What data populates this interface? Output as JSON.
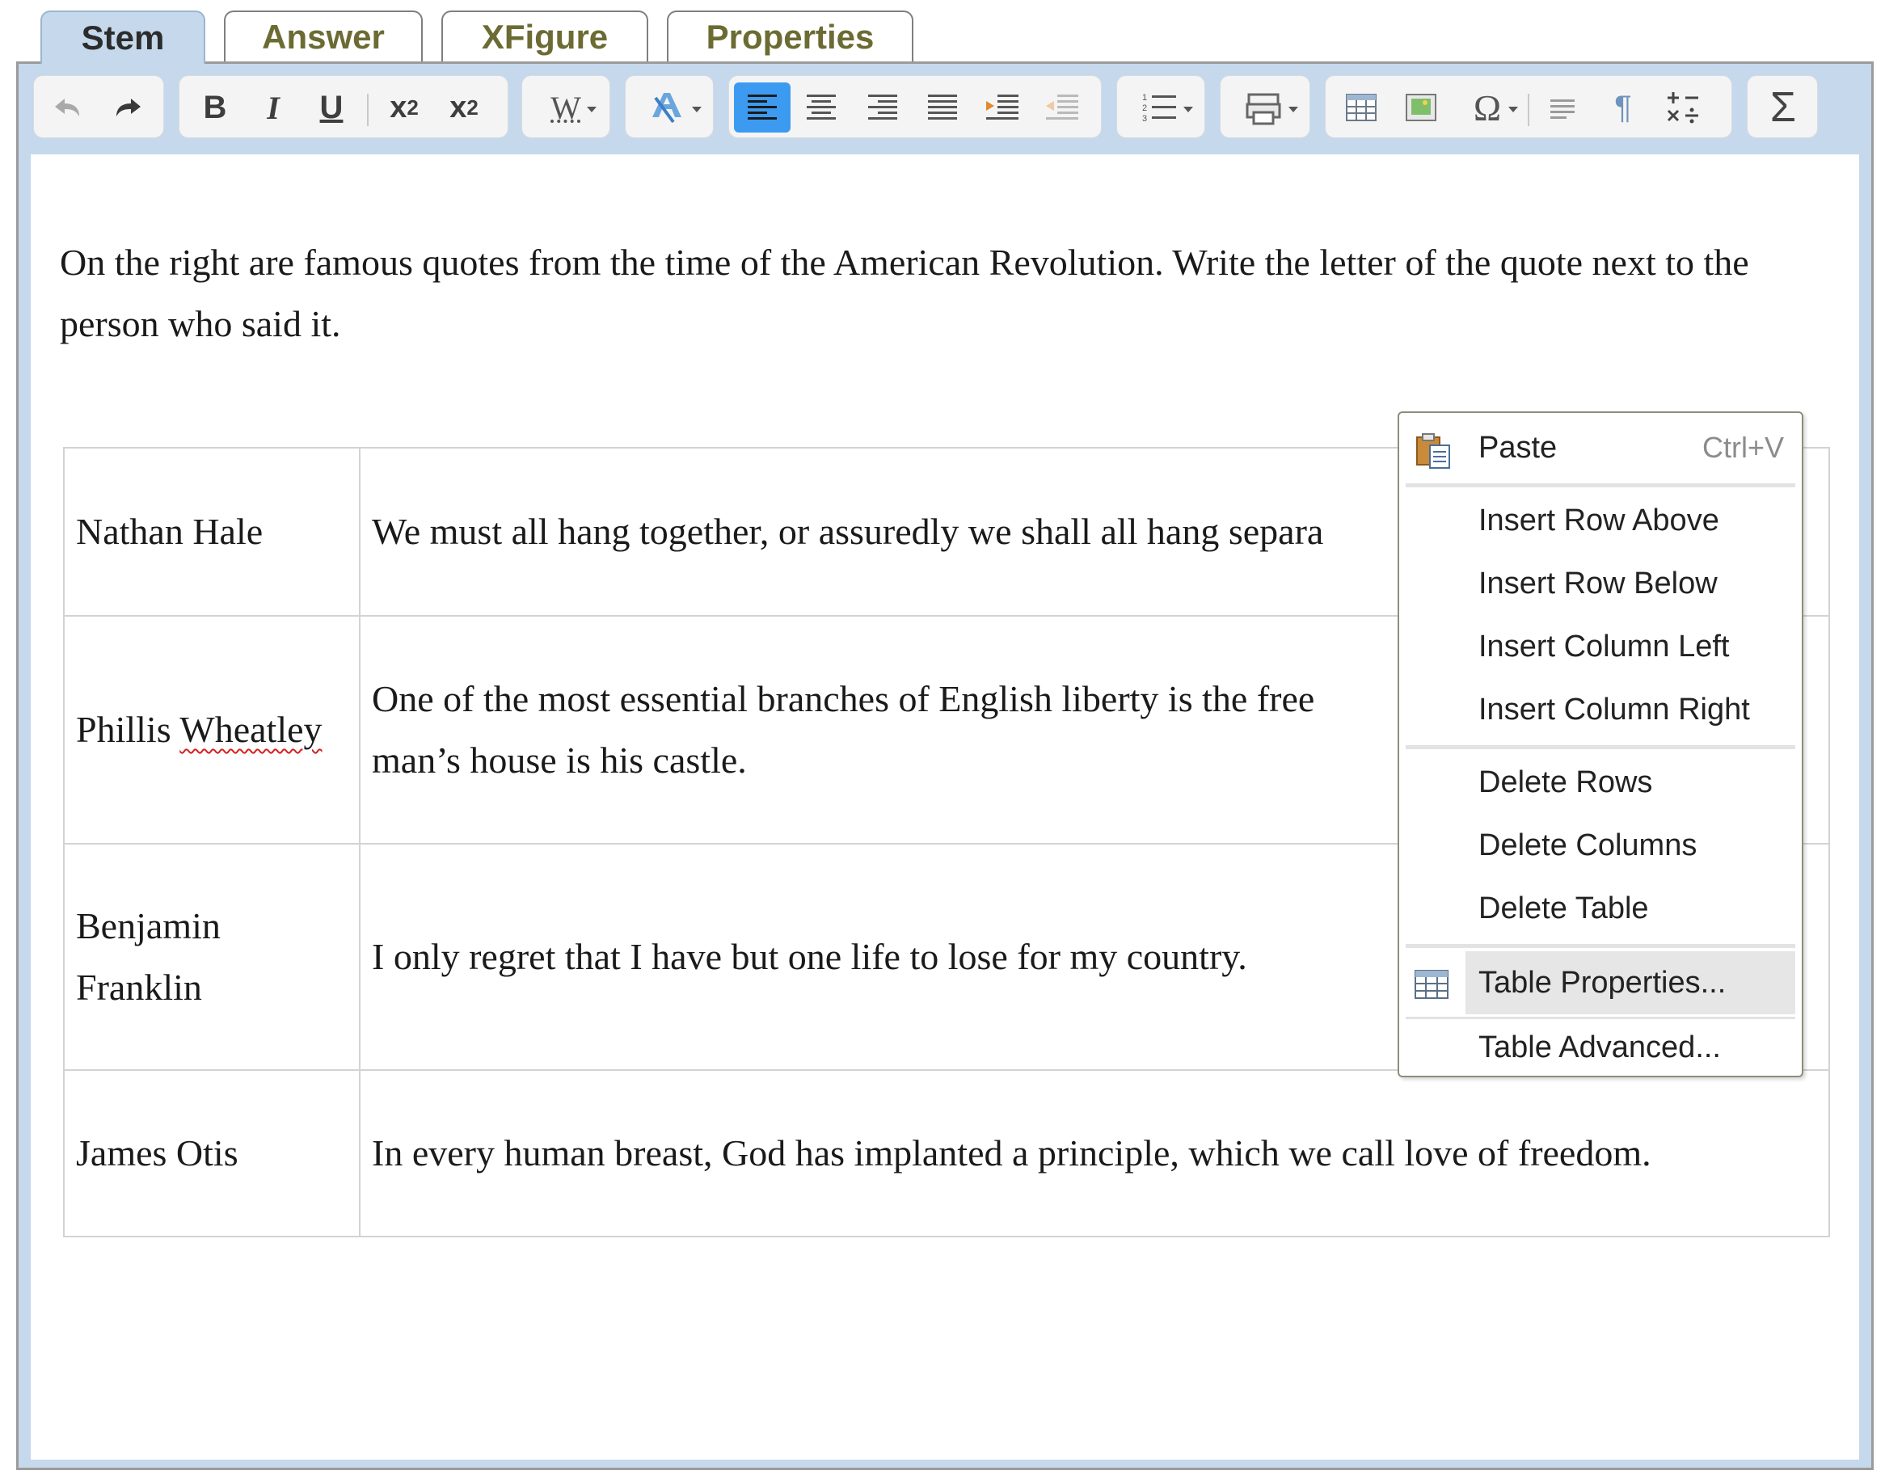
{
  "tabs": [
    {
      "label": "Stem",
      "active": true
    },
    {
      "label": "Answer",
      "active": false
    },
    {
      "label": "XFigure",
      "active": false
    },
    {
      "label": "Properties",
      "active": false
    }
  ],
  "toolbar": {
    "bold": "B",
    "italic": "I",
    "underline": "U",
    "subscript": {
      "base": "x",
      "index": "2"
    },
    "superscript": {
      "base": "x",
      "index": "2"
    },
    "style_glyph": "W",
    "omega": "Ω",
    "pilcrow": "¶",
    "sigma": "Σ"
  },
  "icons": [
    "undo-icon",
    "redo-icon",
    "text-color-icon",
    "align-left-icon",
    "align-center-icon",
    "align-right-icon",
    "justify-icon",
    "indent-icon",
    "outdent-icon",
    "numbered-list-icon",
    "print-icon",
    "table-icon",
    "image-icon",
    "paragraph-icon",
    "formula-icon"
  ],
  "colors": {
    "frame": "#c5d8ec",
    "active_button": "#3c9bf0",
    "tab_text": "#6b6b33"
  },
  "instruction": "On the right are famous quotes from the time of the American Revolution. Write the letter of the quote next to the person who said it.",
  "table": {
    "rows": [
      {
        "name": "Nathan Hale",
        "quote": "We must all hang together, or assuredly we shall all hang separa"
      },
      {
        "name_plain": "Phillis ",
        "name_flag": "Wheatley",
        "quote": "One of the most essential branches of English liberty is the free",
        "quote2": "man’s house is his castle."
      },
      {
        "name": "Benjamin",
        "name2": "Franklin",
        "quote": "I only regret that I have but one life to lose for my country."
      },
      {
        "name": "James Otis",
        "quote": "In every human breast, God has implanted a principle, which we call love of freedom."
      }
    ]
  },
  "context_menu": {
    "paste": {
      "label": "Paste",
      "shortcut": "Ctrl+V"
    },
    "insert_row_above": "Insert Row Above",
    "insert_row_below": "Insert Row Below",
    "insert_column_left": "Insert Column Left",
    "insert_column_right": "Insert Column Right",
    "delete_rows": "Delete Rows",
    "delete_columns": "Delete Columns",
    "delete_table": "Delete Table",
    "table_properties": "Table Properties...",
    "table_advanced": "Table Advanced..."
  }
}
